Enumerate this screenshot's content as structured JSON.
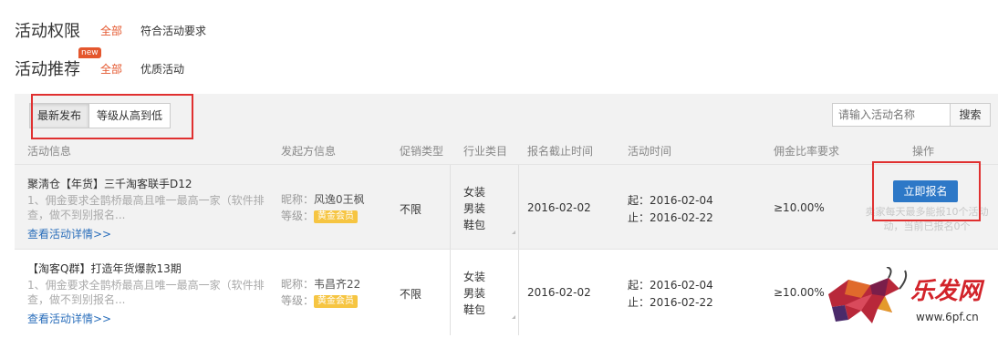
{
  "filters": {
    "permission": {
      "label": "活动权限",
      "options": [
        "全部",
        "符合活动要求"
      ]
    },
    "recommend": {
      "label": "活动推荐",
      "badge": "new",
      "options": [
        "全部",
        "优质活动"
      ]
    }
  },
  "sort": {
    "newest": "最新发布",
    "level": "等级从高到低"
  },
  "search": {
    "placeholder": "请输入活动名称",
    "button": "搜索"
  },
  "table": {
    "headers": [
      "活动信息",
      "发起方信息",
      "促销类型",
      "行业类目",
      "报名截止时间",
      "活动时间",
      "佣金比率要求",
      "操作"
    ],
    "rows": [
      {
        "title": "聚淸仓【年货】三千淘客联手D12",
        "desc": "1、佣金要求全鹊桥最高且唯一最高一家（软件排查，做不到别报名...",
        "link": "查看活动详情>>",
        "nickname_label": "昵称：",
        "nickname": "风逸0王枫",
        "level_label": "等级：",
        "level": "黄金会员",
        "promo": "不限",
        "cats": [
          "女装",
          "男装",
          "鞋包"
        ],
        "deadline": "2016-02-02",
        "start": "起：2016-02-04",
        "end": "止：2016-02-22",
        "commission": "≥10.00%",
        "action": "立即报名",
        "note1": "卖家每天最多能报10个活动",
        "note2": "动，当前已报名0个"
      },
      {
        "title": "【淘客Q群】打造年货爆款13期",
        "desc": "1、佣金要求全鹊桥最高且唯一最高一家（软件排查，做不到别报名...",
        "link": "查看活动详情>>",
        "nickname_label": "昵称：",
        "nickname": "韦昌齐22",
        "level_label": "等级：",
        "level": "黄金会员",
        "promo": "不限",
        "cats": [
          "女装",
          "男装",
          "鞋包"
        ],
        "deadline": "2016-02-02",
        "start": "起：2016-02-04",
        "end": "止：2016-02-22",
        "commission": "≥10.00%"
      }
    ]
  },
  "watermark": {
    "brand": "乐发网",
    "url": "www.6pf.cn"
  },
  "colors": {
    "accent": "#e4572e",
    "button": "#2d78c7",
    "highlight_box": "#e03030",
    "vip": "#f6c542"
  }
}
